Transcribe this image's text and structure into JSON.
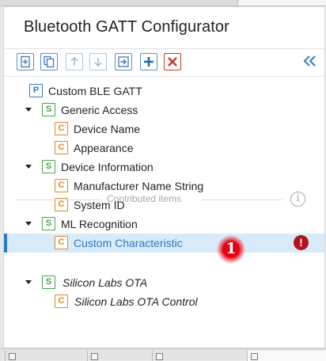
{
  "header": {
    "title": "Bluetooth GATT Configurator"
  },
  "toolbar": {
    "buttons": [
      {
        "name": "add-item-icon",
        "state": "enabled"
      },
      {
        "name": "duplicate-icon",
        "state": "enabled"
      },
      {
        "name": "move-up-icon",
        "state": "disabled"
      },
      {
        "name": "move-down-icon",
        "state": "disabled"
      },
      {
        "name": "import-icon",
        "state": "enabled"
      },
      {
        "name": "plus-icon",
        "state": "enabled"
      },
      {
        "name": "delete-icon",
        "state": "enabled"
      }
    ],
    "collapse_icon": "double-chevron-left-icon"
  },
  "tree": {
    "profile": {
      "badge": "P",
      "label": "Custom BLE GATT"
    },
    "services": [
      {
        "badge": "S",
        "label": "Generic Access",
        "expanded": true,
        "characteristics": [
          {
            "badge": "C",
            "label": "Device Name"
          },
          {
            "badge": "C",
            "label": "Appearance"
          }
        ]
      },
      {
        "badge": "S",
        "label": "Device Information",
        "expanded": true,
        "characteristics": [
          {
            "badge": "C",
            "label": "Manufacturer Name String"
          },
          {
            "badge": "C",
            "label": "System ID"
          }
        ]
      },
      {
        "badge": "S",
        "label": "ML Recognition",
        "expanded": true,
        "characteristics": [
          {
            "badge": "C",
            "label": "Custom Characteristic",
            "selected": true,
            "status": "error"
          }
        ]
      }
    ],
    "contributed": {
      "label": "Contributed items",
      "services": [
        {
          "badge": "S",
          "label": "Silicon Labs OTA",
          "expanded": true,
          "characteristics": [
            {
              "badge": "C",
              "label": "Silicon Labs OTA Control"
            }
          ]
        }
      ]
    }
  },
  "status_icons": {
    "error": "!",
    "info": "i"
  },
  "annotation": {
    "marker_number": "1"
  },
  "colors": {
    "accent": "#2c7bd1",
    "profile_badge": "#2f7cc4",
    "service_badge": "#4aa34a",
    "characteristic_badge": "#e08a1e",
    "error": "#b3131e",
    "selection_bg": "#d9ebf9"
  }
}
